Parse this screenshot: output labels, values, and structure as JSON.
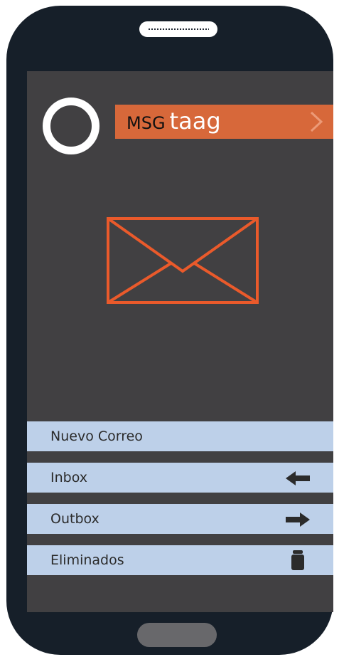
{
  "app": {
    "brand_prefix": "MSG",
    "brand_name": "taag"
  },
  "icons": {
    "logo": "circle-ring-icon",
    "brand_action": "chevron-right-icon",
    "hero": "envelope-icon",
    "inbox": "arrow-left-icon",
    "outbox": "arrow-right-icon",
    "deleted": "trash-can-icon"
  },
  "menu": {
    "new_mail": "Nuevo Correo",
    "inbox": "Inbox",
    "outbox": "Outbox",
    "deleted": "Eliminados"
  },
  "colors": {
    "phone_body": "#161f29",
    "screen_background": "#414042",
    "accent": "#d7683a",
    "envelope_stroke": "#ea5a2b",
    "menu_background": "#bdd0e9",
    "text_dark": "#2b2b2b",
    "home_button": "#68686b"
  }
}
